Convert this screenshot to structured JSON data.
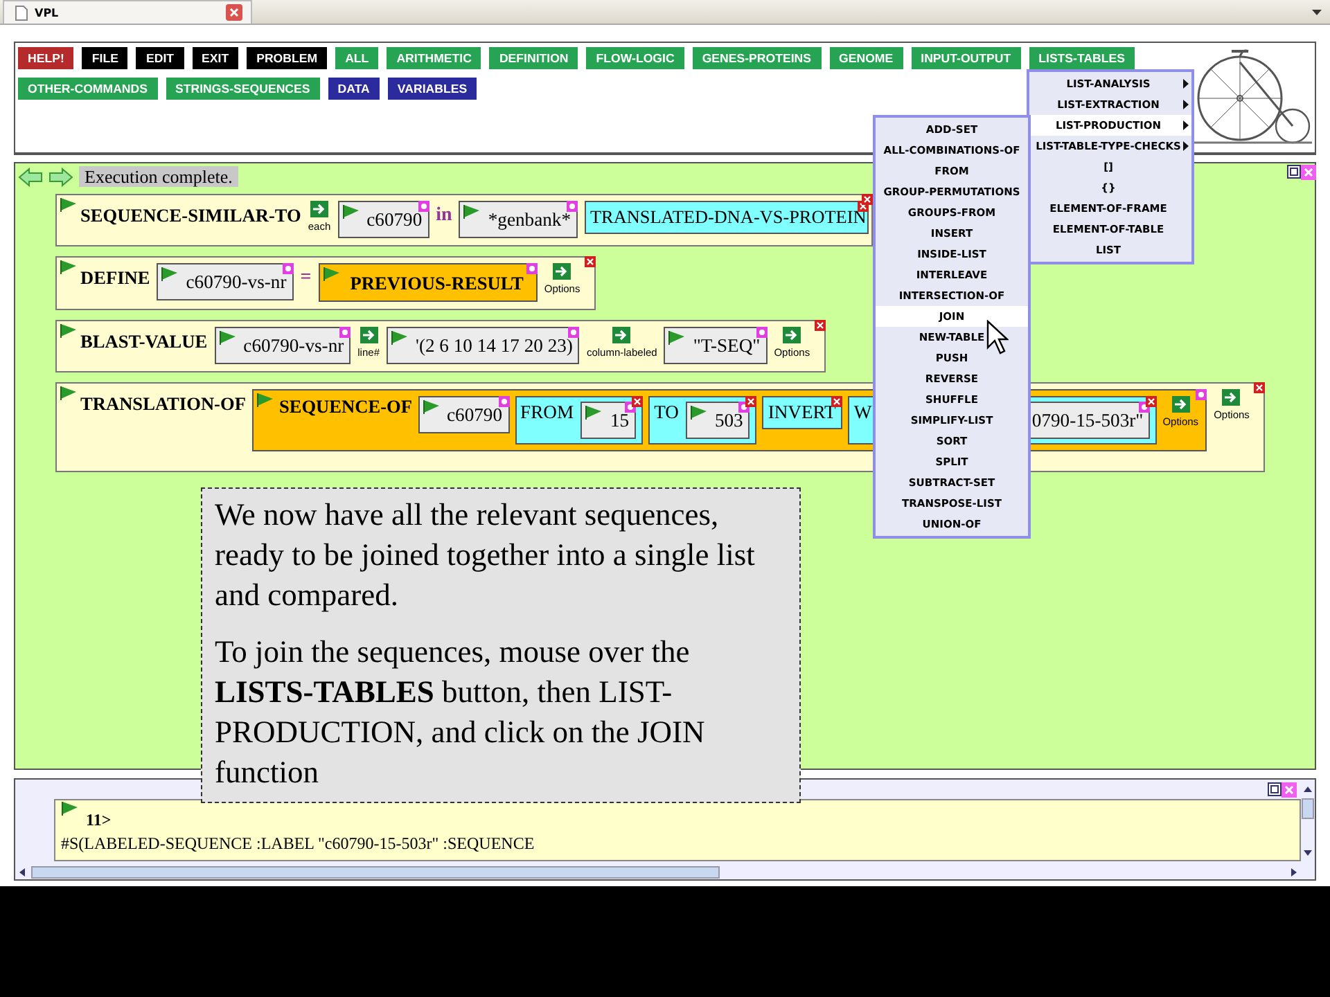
{
  "browser_tab": {
    "title": "VPL"
  },
  "toolbar": {
    "rows": [
      {
        "buttons": [
          {
            "label": "HELP!",
            "color": "#b52a2a"
          },
          {
            "label": "FILE",
            "color": "#000000"
          },
          {
            "label": "EDIT",
            "color": "#000000"
          },
          {
            "label": "EXIT",
            "color": "#000000"
          },
          {
            "label": "PROBLEM",
            "color": "#000000"
          },
          {
            "label": "ALL",
            "color": "#26a453"
          },
          {
            "label": "ARITHMETIC",
            "color": "#26a453"
          },
          {
            "label": "DEFINITION",
            "color": "#26a453"
          },
          {
            "label": "FLOW-LOGIC",
            "color": "#26a453"
          },
          {
            "label": "GENES-PROTEINS",
            "color": "#26a453"
          },
          {
            "label": "GENOME",
            "color": "#26a453"
          },
          {
            "label": "INPUT-OUTPUT",
            "color": "#26a453"
          },
          {
            "label": "LISTS-TABLES",
            "color": "#26a453"
          }
        ]
      },
      {
        "buttons": [
          {
            "label": "OTHER-COMMANDS",
            "color": "#26a453"
          },
          {
            "label": "STRINGS-SEQUENCES",
            "color": "#26a453"
          },
          {
            "label": "DATA",
            "color": "#2b2b9e"
          },
          {
            "label": "VARIABLES",
            "color": "#2b2b9e"
          }
        ]
      }
    ]
  },
  "workspace": {
    "status": "Execution complete.",
    "rows": [
      {
        "kind": "command",
        "label": "SEQUENCE-SIMILAR-TO",
        "children": [
          {
            "kind": "arrow-label",
            "text": "each"
          },
          {
            "kind": "slot",
            "value": "c60790"
          },
          {
            "kind": "word",
            "text": "in"
          },
          {
            "kind": "slot",
            "value": "*genbank*"
          },
          {
            "kind": "keyword-box",
            "label": "TRANSLATED-DNA-VS-PROTEIN"
          }
        ]
      },
      {
        "kind": "command",
        "label": "DEFINE",
        "children": [
          {
            "kind": "slot",
            "value": "c60790-vs-nr"
          },
          {
            "kind": "word",
            "text": "="
          },
          {
            "kind": "function",
            "label": "PREVIOUS-RESULT"
          },
          {
            "kind": "arrow-label",
            "text": "Options"
          }
        ]
      },
      {
        "kind": "command",
        "label": "BLAST-VALUE",
        "children": [
          {
            "kind": "slot",
            "value": "c60790-vs-nr"
          },
          {
            "kind": "arrow-label",
            "text": "line#"
          },
          {
            "kind": "slot",
            "value": "'(2 6 10 14 17 20 23)"
          },
          {
            "kind": "arrow-label",
            "text": "column-labeled"
          },
          {
            "kind": "slot",
            "value": "\"T-SEQ\""
          },
          {
            "kind": "arrow-label",
            "text": "Options"
          }
        ]
      },
      {
        "kind": "command",
        "label": "TRANSLATION-OF",
        "children": [
          {
            "kind": "function",
            "label": "SEQUENCE-OF",
            "children": [
              {
                "kind": "slot",
                "value": "c60790"
              },
              {
                "kind": "keyword-box",
                "label": "FROM",
                "children": [
                  {
                    "kind": "slot",
                    "value": "15"
                  }
                ]
              },
              {
                "kind": "keyword-box",
                "label": "TO",
                "children": [
                  {
                    "kind": "slot",
                    "value": "503"
                  }
                ]
              },
              {
                "kind": "keyword-box",
                "label": "INVERT"
              },
              {
                "kind": "keyword-box",
                "label": "W",
                "children": [
                  {
                    "kind": "slot",
                    "value": "0790-15-503r\""
                  }
                ]
              },
              {
                "kind": "arrow-label",
                "text": "Options"
              }
            ]
          },
          {
            "kind": "arrow-label",
            "text": "Options"
          }
        ]
      }
    ]
  },
  "note": {
    "paragraphs": [
      "We now have all the relevant sequences, ready to be joined together into a single list and compared.",
      "To join the sequences, mouse over the **LISTS-TABLES** button, then LIST-PRODUCTION, and click on the JOIN function"
    ]
  },
  "menus": [
    {
      "items": [
        {
          "label": "LIST-ANALYSIS",
          "submenu": true,
          "selected": false
        },
        {
          "label": "LIST-EXTRACTION",
          "submenu": true,
          "selected": false
        },
        {
          "label": "LIST-PRODUCTION",
          "submenu": true,
          "selected": true
        },
        {
          "label": "LIST-TABLE-TYPE-CHECKS",
          "submenu": true,
          "selected": false
        },
        {
          "label": "[]",
          "submenu": false,
          "selected": false
        },
        {
          "label": "{}",
          "submenu": false,
          "selected": false
        },
        {
          "label": "ELEMENT-OF-FRAME",
          "submenu": false,
          "selected": false
        },
        {
          "label": "ELEMENT-OF-TABLE",
          "submenu": false,
          "selected": false
        },
        {
          "label": "LIST",
          "submenu": false,
          "selected": false
        }
      ]
    },
    {
      "items": [
        {
          "label": "ADD-SET",
          "submenu": false,
          "selected": false
        },
        {
          "label": "ALL-COMBINATIONS-OF",
          "submenu": false,
          "selected": false
        },
        {
          "label": "FROM",
          "submenu": false,
          "selected": false
        },
        {
          "label": "GROUP-PERMUTATIONS",
          "submenu": false,
          "selected": false
        },
        {
          "label": "GROUPS-FROM",
          "submenu": false,
          "selected": false
        },
        {
          "label": "INSERT",
          "submenu": false,
          "selected": false
        },
        {
          "label": "INSIDE-LIST",
          "submenu": false,
          "selected": false
        },
        {
          "label": "INTERLEAVE",
          "submenu": false,
          "selected": false
        },
        {
          "label": "INTERSECTION-OF",
          "submenu": false,
          "selected": false
        },
        {
          "label": "JOIN",
          "submenu": false,
          "selected": true
        },
        {
          "label": "NEW-TABLE",
          "submenu": false,
          "selected": false
        },
        {
          "label": "PUSH",
          "submenu": false,
          "selected": false
        },
        {
          "label": "REVERSE",
          "submenu": false,
          "selected": false
        },
        {
          "label": "SHUFFLE",
          "submenu": false,
          "selected": false
        },
        {
          "label": "SIMPLIFY-LIST",
          "submenu": false,
          "selected": false
        },
        {
          "label": "SORT",
          "submenu": false,
          "selected": false
        },
        {
          "label": "SPLIT",
          "submenu": false,
          "selected": false
        },
        {
          "label": "SUBTRACT-SET",
          "submenu": false,
          "selected": false
        },
        {
          "label": "TRANSPOSE-LIST",
          "submenu": false,
          "selected": false
        },
        {
          "label": "UNION-OF",
          "submenu": false,
          "selected": false
        }
      ]
    }
  ],
  "listener": {
    "prompt": "11>",
    "output": "#S(LABELED-SEQUENCE :LABEL \"c60790-15-503r\" :SEQUENCE"
  }
}
